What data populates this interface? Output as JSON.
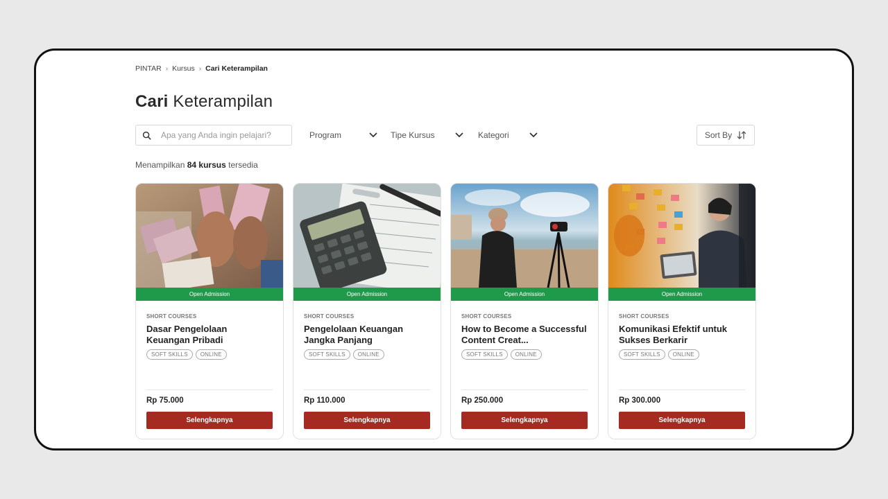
{
  "breadcrumb": {
    "items": [
      "PINTAR",
      "Kursus"
    ],
    "current": "Cari Keterampilan"
  },
  "page_title": {
    "bold": "Cari",
    "light": "Keterampilan"
  },
  "search": {
    "placeholder": "Apa yang Anda ingin pelajari?",
    "value": "",
    "icon": "search-icon"
  },
  "filters": {
    "program": "Program",
    "tipe_kursus": "Tipe Kursus",
    "kategori": "Kategori",
    "sort_by": "Sort By"
  },
  "results": {
    "prefix": "Menampilkan",
    "count": "84 kursus",
    "suffix": "tersedia"
  },
  "colors": {
    "admission": "#1f9a4b",
    "cta": "#a52a22"
  },
  "courses": [
    {
      "admission": "Open Admission",
      "type": "SHORT COURSES",
      "title": "Dasar Pengelolaan Keuangan Pribadi",
      "tags": [
        "SOFT SKILLS",
        "ONLINE"
      ],
      "price": "Rp 75.000",
      "cta": "Selengkapnya"
    },
    {
      "admission": "Open Admission",
      "type": "SHORT COURSES",
      "title": "Pengelolaan Keuangan Jangka Panjang",
      "tags": [
        "SOFT SKILLS",
        "ONLINE"
      ],
      "price": "Rp 110.000",
      "cta": "Selengkapnya"
    },
    {
      "admission": "Open Admission",
      "type": "SHORT COURSES",
      "title": "How to Become a Successful Content Creat...",
      "tags": [
        "SOFT SKILLS",
        "ONLINE"
      ],
      "price": "Rp 250.000",
      "cta": "Selengkapnya"
    },
    {
      "admission": "Open Admission",
      "type": "SHORT COURSES",
      "title": "Komunikasi Efektif untuk Sukses Berkarir",
      "tags": [
        "SOFT SKILLS",
        "ONLINE"
      ],
      "price": "Rp 300.000",
      "cta": "Selengkapnya"
    }
  ]
}
